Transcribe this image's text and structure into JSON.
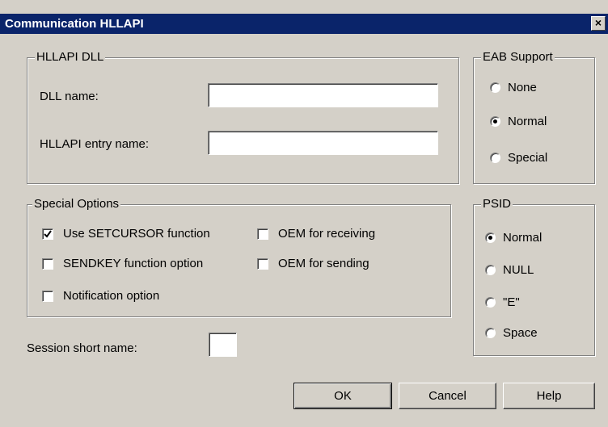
{
  "window": {
    "title": "Communication HLLAPI",
    "close_glyph": "×"
  },
  "hllapi_dll": {
    "legend": "HLLAPI DLL",
    "dll_name_label": "DLL name:",
    "dll_name_value": "",
    "entry_name_label": "HLLAPI entry name:",
    "entry_name_value": ""
  },
  "eab_support": {
    "legend": "EAB Support",
    "options": [
      {
        "label": "None",
        "selected": false
      },
      {
        "label": "Normal",
        "selected": true
      },
      {
        "label": "Special",
        "selected": false
      }
    ]
  },
  "special_options": {
    "legend": "Special Options",
    "checkboxes": [
      {
        "label": "Use SETCURSOR function",
        "checked": true
      },
      {
        "label": "SENDKEY  function option",
        "checked": false
      },
      {
        "label": "Notification option",
        "checked": false
      },
      {
        "label": "OEM for receiving",
        "checked": false
      },
      {
        "label": "OEM for sending",
        "checked": false
      }
    ]
  },
  "psid": {
    "legend": "PSID",
    "options": [
      {
        "label": "Normal",
        "selected": true
      },
      {
        "label": "NULL",
        "selected": false
      },
      {
        "label": "\"E\"",
        "selected": false
      },
      {
        "label": "Space",
        "selected": false
      }
    ]
  },
  "session": {
    "label": "Session short name:",
    "value": ""
  },
  "buttons": {
    "ok": "OK",
    "cancel": "Cancel",
    "help": "Help"
  }
}
